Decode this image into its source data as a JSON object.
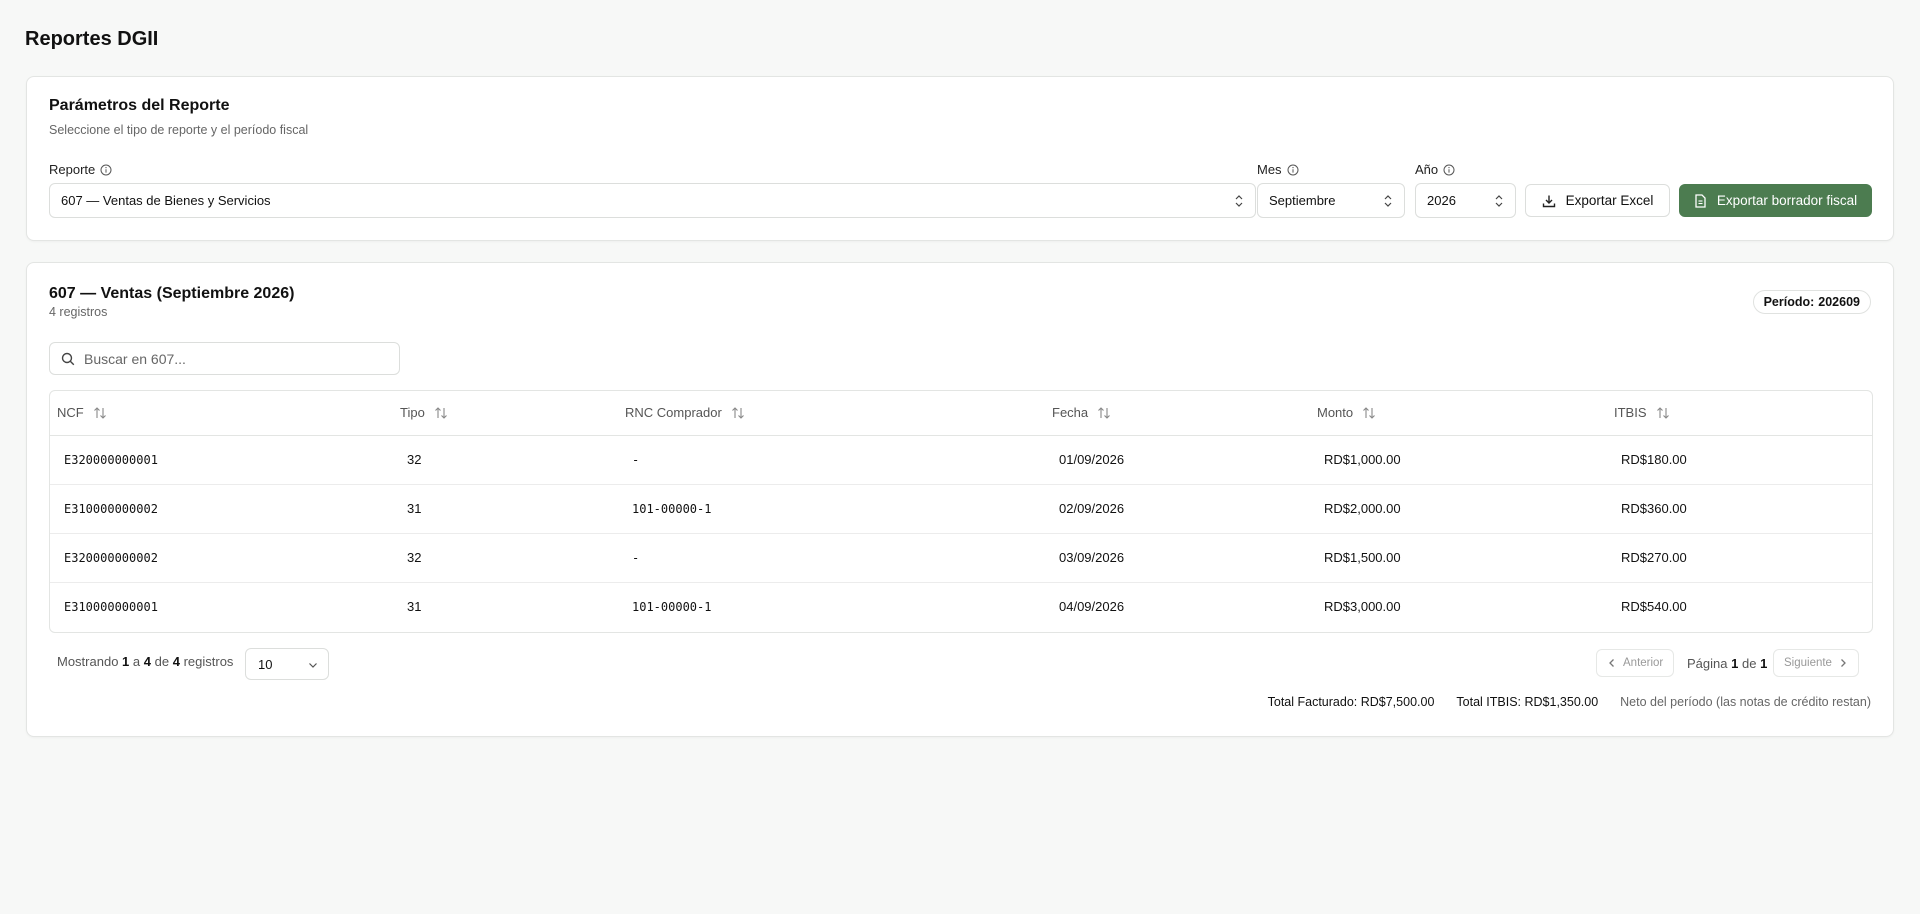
{
  "page": {
    "title": "Reportes DGII"
  },
  "params": {
    "title": "Parámetros del Reporte",
    "subtitle": "Seleccione el tipo de reporte y el período fiscal",
    "report_label": "Reporte",
    "report_value": "607 — Ventas de Bienes y Servicios",
    "month_label": "Mes",
    "month_value": "Septiembre",
    "year_label": "Año",
    "year_value": "2026",
    "export_excel": "Exportar Excel",
    "export_fiscal": "Exportar borrador fiscal",
    "accent_color": "#4c7c50"
  },
  "results": {
    "title": "607 — Ventas (Septiembre 2026)",
    "count": "4 registros",
    "period_label": "Período:",
    "period_value": "202609",
    "search_placeholder": "Buscar en 607...",
    "columns": [
      "NCF",
      "Tipo",
      "RNC Comprador",
      "Fecha",
      "Monto",
      "ITBIS"
    ],
    "rows": [
      [
        "E320000000001",
        "32",
        "-",
        "01/09/2026",
        "RD$1,000.00",
        "RD$180.00"
      ],
      [
        "E310000000002",
        "31",
        "101-00000-1",
        "02/09/2026",
        "RD$2,000.00",
        "RD$360.00"
      ],
      [
        "E320000000002",
        "32",
        "-",
        "03/09/2026",
        "RD$1,500.00",
        "RD$270.00"
      ],
      [
        "E310000000001",
        "31",
        "101-00000-1",
        "04/09/2026",
        "RD$3,000.00",
        "RD$540.00"
      ]
    ]
  },
  "pagination": {
    "showing_prefix": "Mostrando",
    "from": "1",
    "to_word": "a",
    "to": "4",
    "of_word": "de",
    "total": "4",
    "records_word": "registros",
    "page_size": "10",
    "prev": "Anterior",
    "next": "Siguiente",
    "page_word": "Página",
    "page": "1",
    "page_of_word": "de",
    "page_total": "1"
  },
  "totals": {
    "billed": "Total Facturado: RD$7,500.00",
    "itbis": "Total ITBIS: RD$1,350.00",
    "note": "Neto del período (las notas de crédito restan)"
  }
}
